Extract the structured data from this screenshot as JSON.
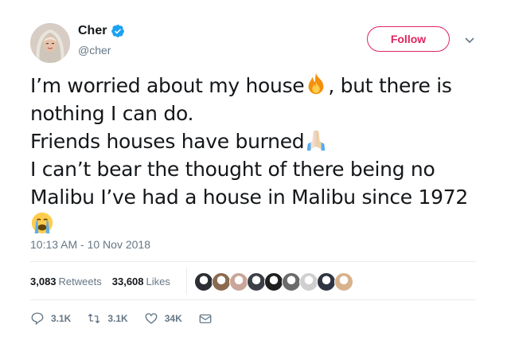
{
  "author": {
    "name": "Cher",
    "handle": "@cher",
    "verified_icon": "verified-badge-icon",
    "avatar_icon": "avatar-photo"
  },
  "follow_button": {
    "label": "Follow",
    "color": "#e0245e"
  },
  "menu_icon": "chevron-down-icon",
  "tweet": {
    "line1_a": "I’m worried about my house",
    "line1_emoji": "fire-emoji",
    "line1_b": ", but there is",
    "line2": "nothing I can do.",
    "line3_a": "Friends houses have burned",
    "line3_emoji": "folded-hands-emoji",
    "line4": "I can’t bear the thought of there being no",
    "line5": "Malibu I’ve had a house in Malibu since 1972",
    "line6_emoji": "loudly-crying-face-emoji"
  },
  "timestamp": "10:13 AM - 10 Nov 2018",
  "stats": {
    "retweets_count": "3,083",
    "retweets_label": "Retweets",
    "likes_count": "33,608",
    "likes_label": "Likes"
  },
  "liker_colors": [
    "#2b2f33",
    "#8a6a4f",
    "#c9a59a",
    "#3c3f47",
    "#1f1f1f",
    "#6b6b6b",
    "#cfcfcf",
    "#2e3440",
    "#d8b28c"
  ],
  "actions": {
    "reply_count": "3.1K",
    "retweet_count": "3.1K",
    "like_count": "34K"
  },
  "colors": {
    "text": "#14171a",
    "muted": "#657786",
    "verified": "#1da1f2",
    "divider": "#e6ecf0"
  }
}
